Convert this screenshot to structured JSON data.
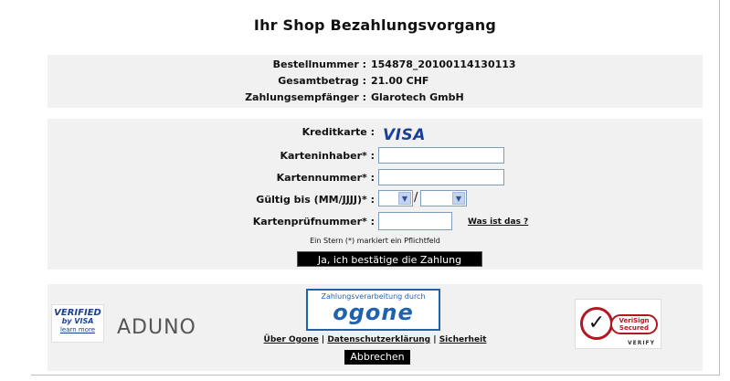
{
  "title": "Ihr Shop Bezahlungsvorgang",
  "order": {
    "order_number_label": "Bestellnummer :",
    "order_number": "154878_20100114130113",
    "total_label": "Gesamtbetrag :",
    "total": "21.00 CHF",
    "recipient_label": "Zahlungsempfänger :",
    "recipient": "Glarotech GmbH"
  },
  "form": {
    "card_label": "Kreditkarte :",
    "card_brand": "VISA",
    "holder_label": "Karteninhaber* :",
    "holder_value": "",
    "number_label": "Kartennummer* :",
    "number_value": "",
    "expiry_label": "Gültig bis (MM/JJJJ)* :",
    "expiry_separator": "/",
    "cvc_label": "Kartenprüfnummer* :",
    "cvc_value": "",
    "cvc_help_link": "Was ist das ?",
    "required_note": "Ein Stern (*) markiert ein Pflichtfeld",
    "confirm_button": "Ja, ich bestätige die Zahlung"
  },
  "footer": {
    "vbv_line1": "VERIFIED",
    "vbv_line2": "by VISA",
    "vbv_line3": "learn more",
    "aduno": "ADUNO",
    "ogone_caption": "Zahlungsverarbeitung durch",
    "ogone_name": "ogone",
    "links": [
      "Über Ogone",
      "Datenschutzerklärung",
      "Sicherheit"
    ],
    "link_separator": "|",
    "cancel_button": "Abbrechen",
    "verisign_line1": "VeriSign",
    "verisign_line2": "Secured",
    "verisign_verify": "VERIFY"
  },
  "colors": {
    "panel": "#f1f1f1",
    "visa_blue": "#1a3f95",
    "ogone_blue": "#1f63b0",
    "verisign_red": "#b01922"
  }
}
